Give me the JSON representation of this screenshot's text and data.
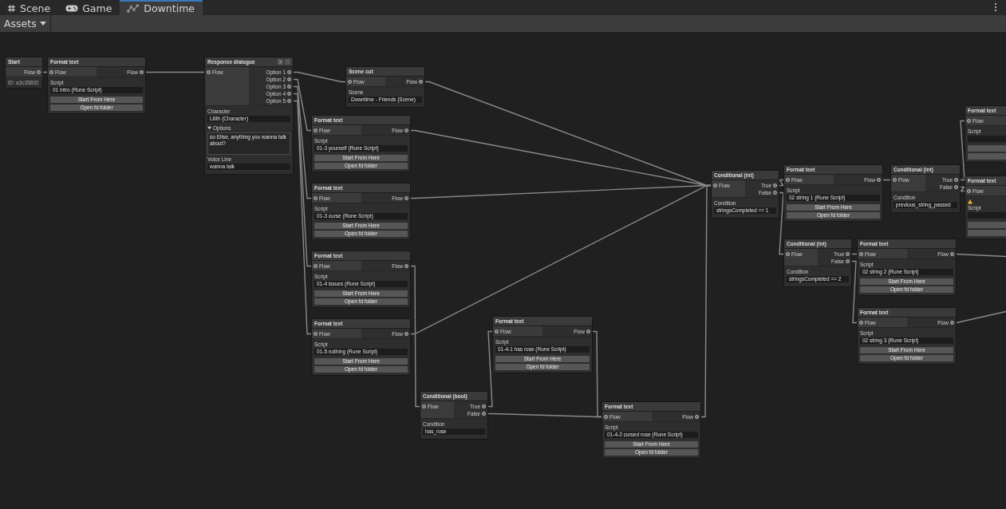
{
  "tabs": [
    {
      "label": "Scene",
      "selected": false
    },
    {
      "label": "Game",
      "selected": false
    },
    {
      "label": "Downtime",
      "selected": true
    }
  ],
  "toolbar": {
    "dropdown": "Assets"
  },
  "nodes": [
    {
      "kind": "start",
      "title": "Start",
      "outputs": [
        "Flow"
      ],
      "id": "ID: a3c35892"
    },
    {
      "kind": "format",
      "title": "Format text",
      "input": "Flow",
      "outputs": [
        "Flow"
      ],
      "fields": [
        {
          "label": "Script",
          "value": "01 intro (Rune Script)"
        }
      ],
      "buttons": [
        "Start From Here",
        "Open fd folder"
      ]
    },
    {
      "kind": "dialogue",
      "title": "Response dialogue",
      "input": "Flow",
      "outputs": [
        "Option 1",
        "Option 2",
        "Option 3",
        "Option 4",
        "Option 5"
      ],
      "fields": [
        {
          "label": "Character",
          "value": "Lilith (Character)"
        }
      ],
      "foldout": "Options",
      "expanded": true,
      "text": "so Elise, anything you wanna talk about?",
      "voice": {
        "label": "Voice Line",
        "value": "wanna talk"
      }
    },
    {
      "kind": "scene",
      "title": "Scene cut",
      "input": "Flow",
      "outputs": [
        "Flow"
      ],
      "fields": [
        {
          "label": "Scene",
          "value": "Downtime - Friends (Scene)"
        }
      ]
    },
    {
      "kind": "format",
      "title": "Format text",
      "input": "Flow",
      "outputs": [
        "Flow"
      ],
      "fields": [
        {
          "label": "Script",
          "value": "01-3 yourself (Rune Script)"
        }
      ],
      "buttons": [
        "Start From Here",
        "Open fd folder"
      ]
    },
    {
      "kind": "format",
      "title": "Format text",
      "input": "Flow",
      "outputs": [
        "Flow"
      ],
      "fields": [
        {
          "label": "Script",
          "value": "01-3 curse (Rune Script)"
        }
      ],
      "buttons": [
        "Start From Here",
        "Open fd folder"
      ]
    },
    {
      "kind": "format",
      "title": "Format text",
      "input": "Flow",
      "outputs": [
        "Flow"
      ],
      "fields": [
        {
          "label": "Script",
          "value": "01-4 issues (Rune Script)"
        }
      ],
      "buttons": [
        "Start From Here",
        "Open fd folder"
      ]
    },
    {
      "kind": "format",
      "title": "Format text",
      "input": "Flow",
      "outputs": [
        "Flow"
      ],
      "fields": [
        {
          "label": "Script",
          "value": "01-5 nothing (Rune Script)"
        }
      ],
      "buttons": [
        "Start From Here",
        "Open fd folder"
      ]
    },
    {
      "kind": "condition",
      "title": "Conditional (bool)",
      "input": "Flow",
      "outputs": [
        "True",
        "False"
      ],
      "fields": [
        {
          "label": "Condition",
          "value": "has_rose"
        }
      ]
    },
    {
      "kind": "format",
      "title": "Format text",
      "input": "Flow",
      "outputs": [
        "Flow"
      ],
      "fields": [
        {
          "label": "Script",
          "value": "01-4-1 has rose (Rune Script)"
        }
      ],
      "buttons": [
        "Start From Here",
        "Open fd folder"
      ]
    },
    {
      "kind": "format",
      "title": "Format text",
      "input": "Flow",
      "outputs": [
        "Flow"
      ],
      "fields": [
        {
          "label": "Script",
          "value": "01-4-2 cursed rose (Rune Script)"
        }
      ],
      "buttons": [
        "Start From Here",
        "Open fd folder"
      ]
    },
    {
      "kind": "condition",
      "title": "Conditional (int)",
      "input": "Flow",
      "outputs": [
        "True",
        "False"
      ],
      "fields": [
        {
          "label": "Condition",
          "value": "stringsCompleted == 1"
        }
      ]
    },
    {
      "kind": "format",
      "title": "Format text",
      "input": "Flow",
      "outputs": [
        "Flow"
      ],
      "fields": [
        {
          "label": "Script",
          "value": "02 string 1 (Rune Script)"
        }
      ],
      "buttons": [
        "Start From Here",
        "Open fd folder"
      ]
    },
    {
      "kind": "condition",
      "title": "Conditional (int)",
      "input": "Flow",
      "outputs": [
        "True",
        "False"
      ],
      "fields": [
        {
          "label": "Condition",
          "value": "previous_string_passed"
        }
      ]
    },
    {
      "kind": "condition",
      "title": "Conditional (int)",
      "input": "Flow",
      "outputs": [
        "True",
        "False"
      ],
      "fields": [
        {
          "label": "Condition",
          "value": "stringsCompleted == 2"
        }
      ]
    },
    {
      "kind": "format",
      "title": "Format text",
      "input": "Flow",
      "outputs": [
        "Flow"
      ],
      "fields": [
        {
          "label": "Script",
          "value": "02 string 2 (Rune Script)"
        }
      ],
      "buttons": [
        "Start From Here",
        "Open fd folder"
      ]
    },
    {
      "kind": "format",
      "title": "Format text",
      "input": "Flow",
      "outputs": [
        "Flow"
      ],
      "fields": [
        {
          "label": "Script",
          "value": "02 string 3 (Rune Script)"
        }
      ],
      "buttons": [
        "Start From Here",
        "Open fd folder"
      ]
    },
    {
      "kind": "cut",
      "title": "Format text",
      "input": "Flow",
      "fields": [
        {
          "label": "Script"
        }
      ]
    },
    {
      "kind": "cut",
      "title": "Format text",
      "input": "Flow",
      "warning": true,
      "fields": [
        {
          "label": "Script"
        }
      ]
    }
  ]
}
